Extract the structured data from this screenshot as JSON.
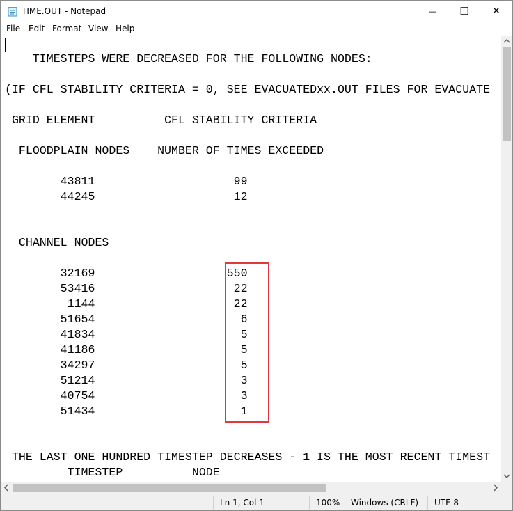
{
  "window": {
    "title": "TIME.OUT - Notepad",
    "minimize_glyph": "—",
    "maximize_glyph": "☐",
    "close_glyph": "✕"
  },
  "menu": [
    "File",
    "Edit",
    "Format",
    "View",
    "Help"
  ],
  "editor": {
    "lines": [
      "    TIMESTEPS WERE DECREASED FOR THE FOLLOWING NODES:",
      "(IF CFL STABILITY CRITERIA = 0, SEE EVACUATEDxx.OUT FILES FOR EVACUATE",
      " GRID ELEMENT          CFL STABILITY CRITERIA",
      "  FLOODPLAIN NODES    NUMBER OF TIMES EXCEEDED",
      "        43811                    99",
      "        44245                    12",
      "  CHANNEL NODES",
      "        32169                   550",
      "        53416                    22",
      "         1144                    22",
      "        51654                     6",
      "        41834                     5",
      "        41186                     5",
      "        34297                     5",
      "        51214                     3",
      "        40754                     3",
      "        51434                     1",
      " THE LAST ONE HUNDRED TIMESTEP DECREASES - 1 IS THE MOST RECENT TIMEST",
      "         TIMESTEP          NODE"
    ]
  },
  "status": {
    "position": "Ln 1, Col 1",
    "zoom": "100%",
    "line_ending": "Windows (CRLF)",
    "encoding": "UTF-8"
  },
  "colors": {
    "highlight": "#e0383e",
    "scroll_thumb": "#c2c2c2",
    "chrome": "#f0f0f0"
  }
}
